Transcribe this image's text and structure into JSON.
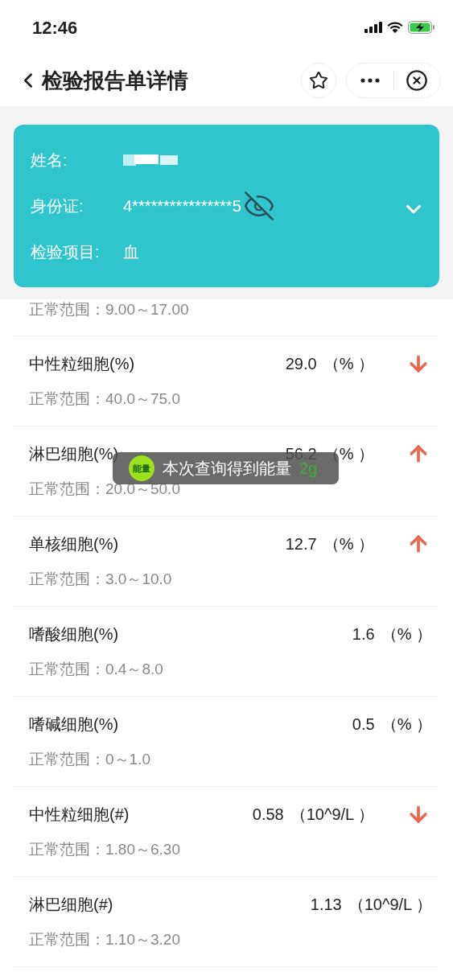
{
  "status_bar": {
    "time": "12:46"
  },
  "nav": {
    "title": "检验报告单详情"
  },
  "patient": {
    "expanded": false,
    "rows": [
      {
        "kind": "redacted",
        "label": "姓名:"
      },
      {
        "kind": "id",
        "label": "身份证:",
        "value": "4****************5"
      },
      {
        "kind": "text",
        "label": "检验项目:",
        "value": "血"
      }
    ]
  },
  "results": [
    {
      "range": "正常范围：9.00～17.00"
    },
    {
      "name": "中性粒细胞(%)",
      "value": "29.0",
      "unit": "（% ）",
      "kind": "low",
      "range": "正常范围：40.0～75.0"
    },
    {
      "name": "淋巴细胞(%)",
      "value": "56.2",
      "unit": "（% ）",
      "kind": "high",
      "range": "正常范围：20.0～50.0"
    },
    {
      "name": "单核细胞(%)",
      "value": "12.7",
      "unit": "（% ）",
      "kind": "high",
      "range": "正常范围：3.0～10.0"
    },
    {
      "name": "嗜酸细胞(%)",
      "value": "1.6",
      "unit": "（% ）",
      "kind": "normal",
      "range": "正常范围：0.4～8.0"
    },
    {
      "name": "嗜碱细胞(%)",
      "value": "0.5",
      "unit": "（% ）",
      "kind": "normal",
      "range": "正常范围：0～1.0"
    },
    {
      "name": "中性粒细胞(#)",
      "value": "0.58",
      "unit": "（10^9/L ）",
      "kind": "low",
      "range": "正常范围：1.80～6.30"
    },
    {
      "name": "淋巴细胞(#)",
      "value": "1.13",
      "unit": "（10^9/L ）",
      "kind": "normal",
      "range": "正常范围：1.10～3.20"
    }
  ],
  "toast": {
    "badge": "能量",
    "message": "本次查询得到能量",
    "amount": "2g"
  }
}
